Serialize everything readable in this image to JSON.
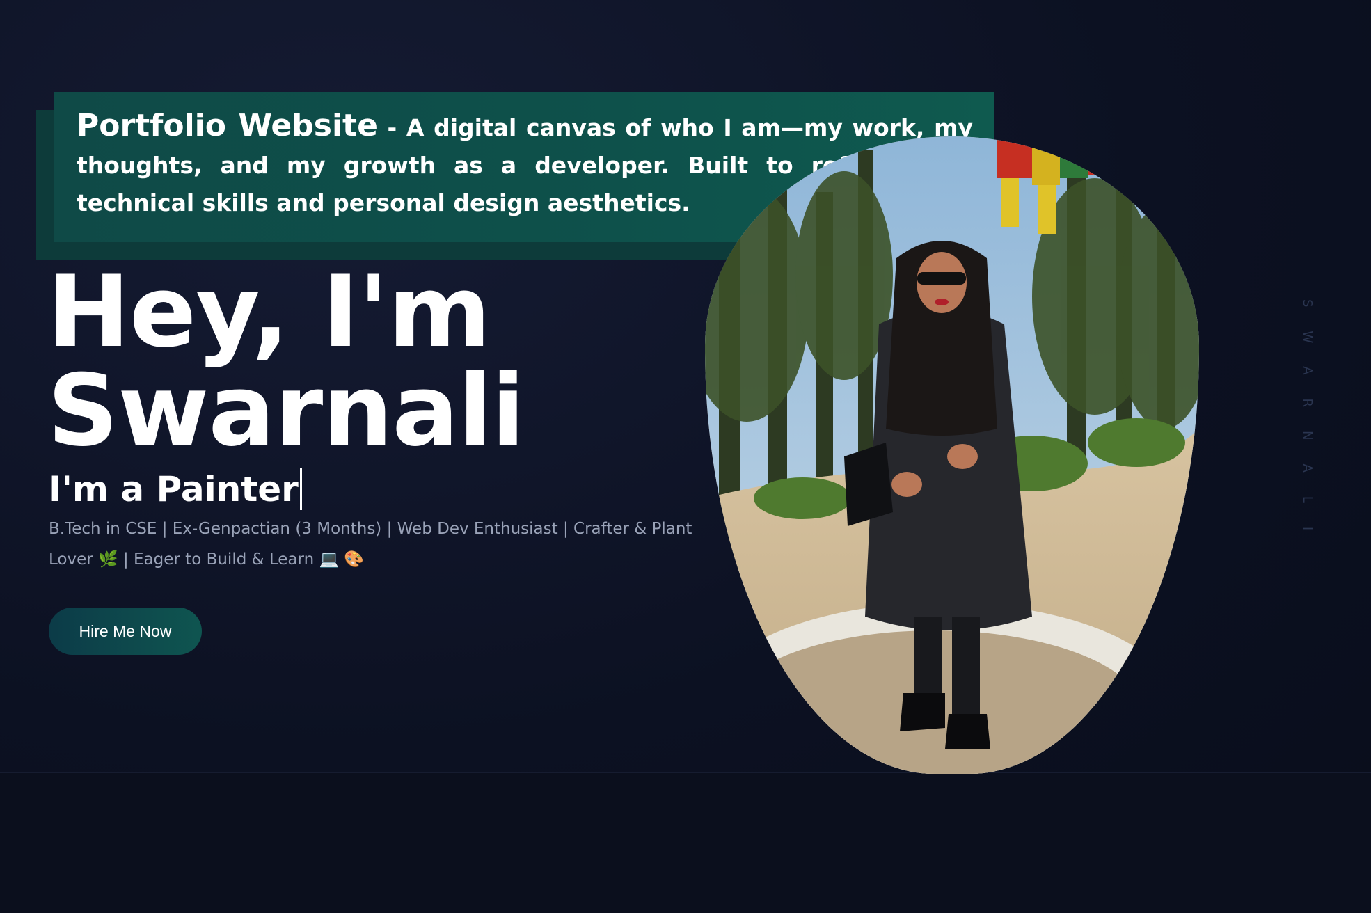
{
  "banner": {
    "title": "Portfolio Website",
    "separator": " - ",
    "description": "A digital canvas of who I am—my work, my thoughts, and my growth as a developer. Built to reflect both technical skills and personal design aesthetics."
  },
  "hero": {
    "greeting_line1": "Hey, I'm",
    "greeting_line2": "Swarnali",
    "typed_prefix": "I'm a ",
    "typed_role": "Painter",
    "tagline_part1": "B.Tech in CSE | Ex-Genpactian (3 Months) | Web Dev Enthusiast | Crafter & Plant Lover ",
    "tagline_emoji1": "🌿",
    "tagline_part2": " | Eager to Build & Learn ",
    "tagline_emoji2": "💻",
    "tagline_emoji3": "🎨",
    "cta_label": "Hire Me Now"
  },
  "side": {
    "vertical_name": "SWARNALI"
  },
  "portrait": {
    "icon": "profile-photo"
  },
  "colors": {
    "background": "#0e1324",
    "banner": "#0f4a47",
    "accent_button": "#0f5550",
    "muted_text": "#9aa3b8"
  }
}
